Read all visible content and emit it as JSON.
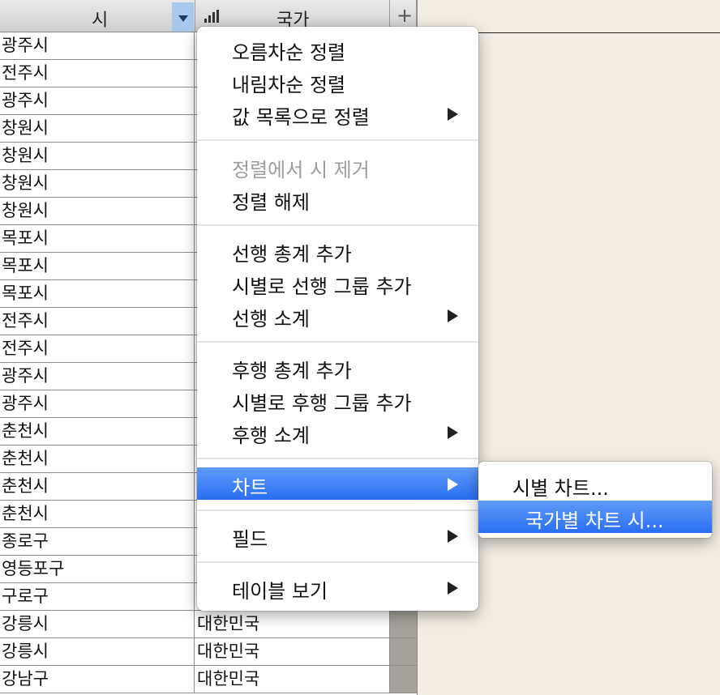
{
  "columns": {
    "city": "시",
    "country": "국가"
  },
  "rows": [
    {
      "city": "광주시",
      "country": ""
    },
    {
      "city": "전주시",
      "country": ""
    },
    {
      "city": "광주시",
      "country": ""
    },
    {
      "city": "창원시",
      "country": ""
    },
    {
      "city": "창원시",
      "country": ""
    },
    {
      "city": "창원시",
      "country": ""
    },
    {
      "city": "창원시",
      "country": ""
    },
    {
      "city": "목포시",
      "country": ""
    },
    {
      "city": "목포시",
      "country": ""
    },
    {
      "city": "목포시",
      "country": ""
    },
    {
      "city": "전주시",
      "country": ""
    },
    {
      "city": "전주시",
      "country": ""
    },
    {
      "city": "광주시",
      "country": ""
    },
    {
      "city": "광주시",
      "country": ""
    },
    {
      "city": "춘천시",
      "country": ""
    },
    {
      "city": "춘천시",
      "country": ""
    },
    {
      "city": "춘천시",
      "country": ""
    },
    {
      "city": "춘천시",
      "country": ""
    },
    {
      "city": "종로구",
      "country": ""
    },
    {
      "city": "영등포구",
      "country": ""
    },
    {
      "city": "구로구",
      "country": ""
    },
    {
      "city": "강릉시",
      "country": "대한민국"
    },
    {
      "city": "강릉시",
      "country": "대한민국"
    },
    {
      "city": "강남구",
      "country": "대한민국"
    }
  ],
  "menu": {
    "sort_asc": "오름차순 정렬",
    "sort_desc": "내림차순 정렬",
    "sort_by_list": "값 목록으로 정렬",
    "remove_from_sort": "정렬에서 시 제거",
    "unsort": "정렬 해제",
    "add_leading_total": "선행 총계 추가",
    "add_leading_group": "시별로 선행 그룹 추가",
    "leading_subtotals": "선행 소계",
    "add_trailing_total": "후행 총계 추가",
    "add_trailing_group": "시별로 후행 그룹 추가",
    "trailing_subtotals": "후행 소계",
    "chart": "차트",
    "field": "필드",
    "table_view": "테이블 보기"
  },
  "submenu": {
    "chart_by_city": "시별 차트...",
    "chart_by_country": "국가별 차트 시..."
  },
  "colors": {
    "menu_highlight": "#2a6ef2",
    "header_sort_button": "#a9c9ec"
  },
  "icons": {
    "sort_dropdown": "triangle-down-icon",
    "chart_field": "bar-chart-icon",
    "add_column": "plus-icon",
    "submenu_arrow": "triangle-right-icon"
  }
}
